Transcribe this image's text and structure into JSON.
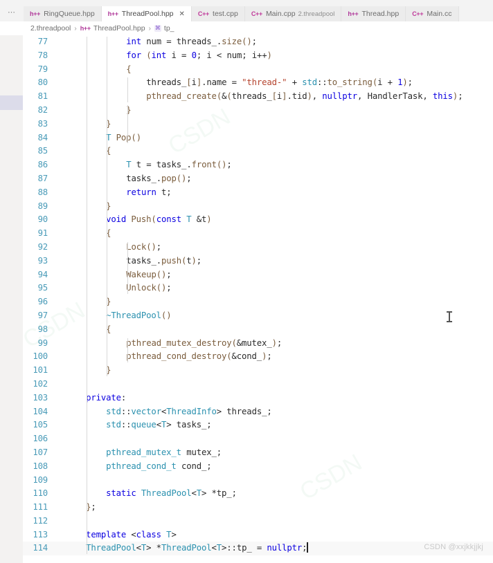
{
  "window": {
    "overflow_label": "⋯"
  },
  "tabs": [
    {
      "icon": "h++",
      "icon_kind": "hpp",
      "label": "RingQueue.hpp",
      "sub": "",
      "active": false,
      "closable": false
    },
    {
      "icon": "h++",
      "icon_kind": "hpp",
      "label": "ThreadPool.hpp",
      "sub": "",
      "active": true,
      "closable": true,
      "close_label": "✕"
    },
    {
      "icon": "C++",
      "icon_kind": "cpp",
      "label": "test.cpp",
      "sub": "",
      "active": false,
      "closable": false
    },
    {
      "icon": "C++",
      "icon_kind": "cpp",
      "label": "Main.cpp",
      "sub": "2.threadpool",
      "active": false,
      "closable": false
    },
    {
      "icon": "h++",
      "icon_kind": "hpp",
      "label": "Thread.hpp",
      "sub": "",
      "active": false,
      "closable": false
    },
    {
      "icon": "C++",
      "icon_kind": "cpp",
      "label": "Main.cc",
      "sub": "",
      "active": false,
      "closable": false
    }
  ],
  "breadcrumb": {
    "sep": "›",
    "items": [
      {
        "icon": "",
        "icon_kind": "none",
        "label": "2.threadpool"
      },
      {
        "icon": "h++",
        "icon_kind": "hpp",
        "label": "ThreadPool.hpp"
      },
      {
        "icon": "⌘",
        "icon_kind": "symbol",
        "label": "tp_"
      }
    ]
  },
  "editor": {
    "first_line": 77,
    "last_line": 114,
    "current_line": 114,
    "colors": {
      "background": "#ffffff",
      "linenumber": "#4a9bb8",
      "keyword": "#0b00e0",
      "type": "#2b91af",
      "string": "#b5432e",
      "function": "#7a5c3c",
      "plain": "#2b2b2b",
      "rail": "#f3f2f1",
      "rail_highlight": "#dcdcea"
    },
    "lines": [
      {
        "n": "77",
        "text": "            int num = threads_.size();"
      },
      {
        "n": "78",
        "text": "            for (int i = 0; i < num; i++)"
      },
      {
        "n": "79",
        "text": "            {"
      },
      {
        "n": "80",
        "text": "                threads_[i].name = \"thread-\" + std::to_string(i + 1);"
      },
      {
        "n": "81",
        "text": "                pthread_create(&(threads_[i].tid), nullptr, HandlerTask, this);"
      },
      {
        "n": "82",
        "text": "            }"
      },
      {
        "n": "83",
        "text": "        }"
      },
      {
        "n": "84",
        "text": "        T Pop()"
      },
      {
        "n": "85",
        "text": "        {"
      },
      {
        "n": "86",
        "text": "            T t = tasks_.front();"
      },
      {
        "n": "87",
        "text": "            tasks_.pop();"
      },
      {
        "n": "88",
        "text": "            return t;"
      },
      {
        "n": "89",
        "text": "        }"
      },
      {
        "n": "90",
        "text": "        void Push(const T &t)"
      },
      {
        "n": "91",
        "text": "        {"
      },
      {
        "n": "92",
        "text": "            Lock();"
      },
      {
        "n": "93",
        "text": "            tasks_.push(t);"
      },
      {
        "n": "94",
        "text": "            Wakeup();"
      },
      {
        "n": "95",
        "text": "            Unlock();"
      },
      {
        "n": "96",
        "text": "        }"
      },
      {
        "n": "97",
        "text": "        ~ThreadPool()"
      },
      {
        "n": "98",
        "text": "        {"
      },
      {
        "n": "99",
        "text": "            pthread_mutex_destroy(&mutex_);"
      },
      {
        "n": "100",
        "text": "            pthread_cond_destroy(&cond_);"
      },
      {
        "n": "101",
        "text": "        }"
      },
      {
        "n": "102",
        "text": ""
      },
      {
        "n": "103",
        "text": "    private:"
      },
      {
        "n": "104",
        "text": "        std::vector<ThreadInfo> threads_;"
      },
      {
        "n": "105",
        "text": "        std::queue<T> tasks_;"
      },
      {
        "n": "106",
        "text": ""
      },
      {
        "n": "107",
        "text": "        pthread_mutex_t mutex_;"
      },
      {
        "n": "108",
        "text": "        pthread_cond_t cond_;"
      },
      {
        "n": "109",
        "text": ""
      },
      {
        "n": "110",
        "text": "        static ThreadPool<T> *tp_;"
      },
      {
        "n": "111",
        "text": "    };"
      },
      {
        "n": "112",
        "text": ""
      },
      {
        "n": "113",
        "text": "    template <class T>"
      },
      {
        "n": "114",
        "text": "    ThreadPool<T> *ThreadPool<T>::tp_ = nullptr;"
      }
    ]
  },
  "watermark": {
    "text": "CSDN @xxjkkjjkj",
    "ghost": "CSDN"
  }
}
